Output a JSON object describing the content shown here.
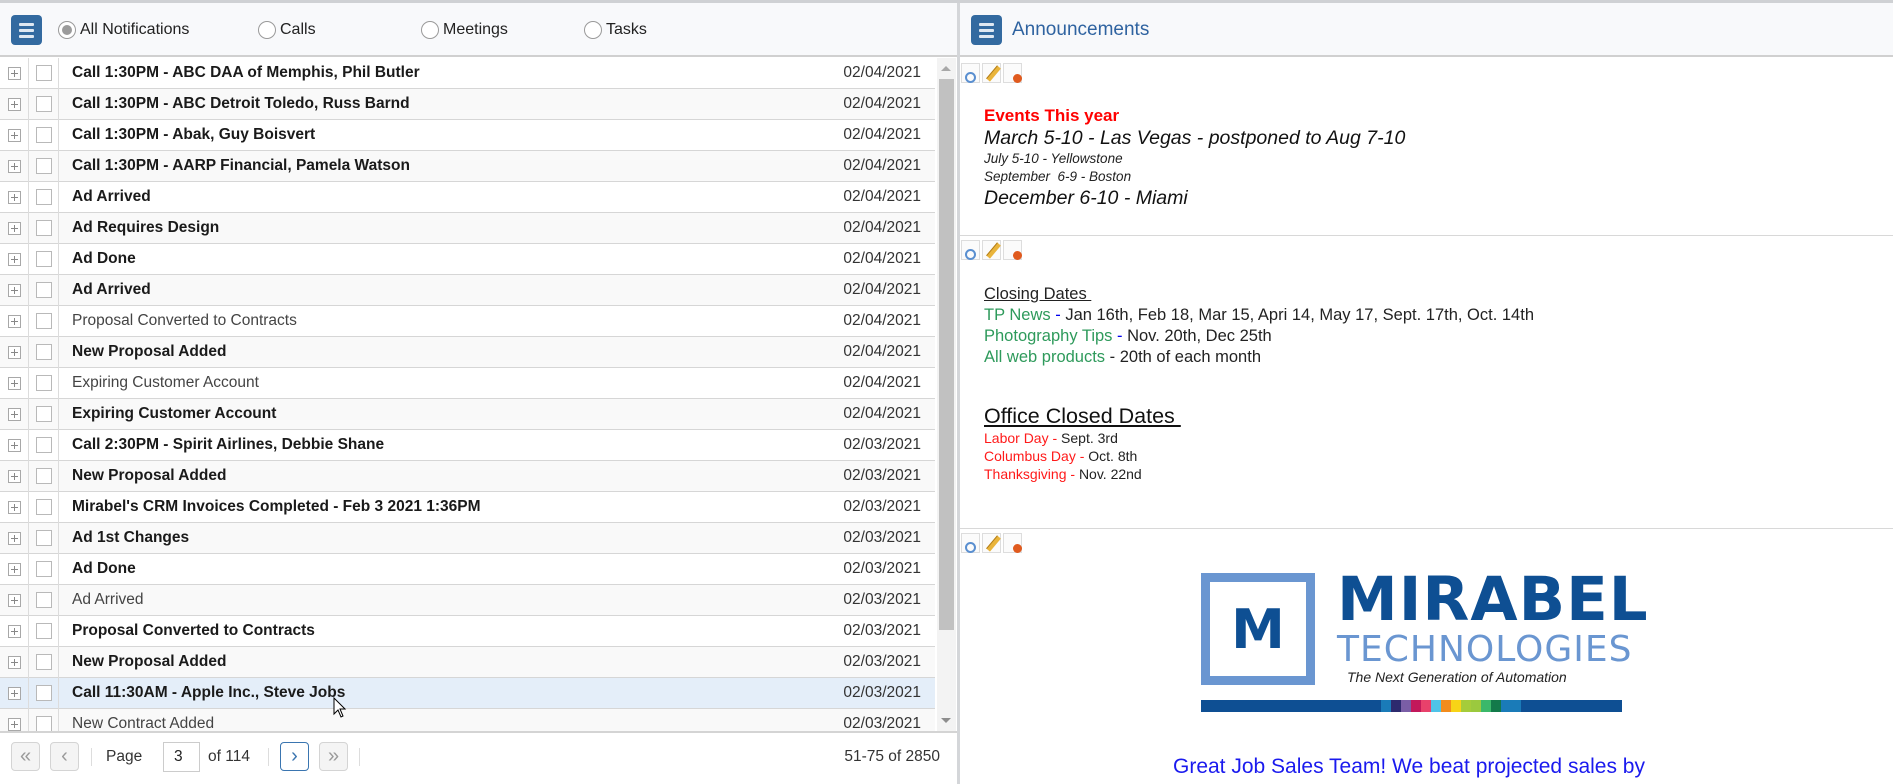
{
  "left_panel": {
    "filters": [
      {
        "label": "All Notifications",
        "selected": true
      },
      {
        "label": "Calls",
        "selected": false
      },
      {
        "label": "Meetings",
        "selected": false
      },
      {
        "label": "Tasks",
        "selected": false
      }
    ],
    "rows": [
      {
        "title": "Call 1:30PM - ABC DAA of Memphis, Phil Butler",
        "date": "02/04/2021",
        "unread": true
      },
      {
        "title": "Call 1:30PM - ABC Detroit Toledo, Russ Barnd",
        "date": "02/04/2021",
        "unread": true
      },
      {
        "title": "Call 1:30PM - Abak, Guy Boisvert",
        "date": "02/04/2021",
        "unread": true
      },
      {
        "title": "Call 1:30PM - AARP Financial, Pamela Watson",
        "date": "02/04/2021",
        "unread": true
      },
      {
        "title": "Ad Arrived",
        "date": "02/04/2021",
        "unread": true
      },
      {
        "title": "Ad Requires Design",
        "date": "02/04/2021",
        "unread": true
      },
      {
        "title": "Ad Done",
        "date": "02/04/2021",
        "unread": true
      },
      {
        "title": "Ad Arrived",
        "date": "02/04/2021",
        "unread": true
      },
      {
        "title": "Proposal Converted to Contracts",
        "date": "02/04/2021",
        "unread": false
      },
      {
        "title": "New Proposal Added",
        "date": "02/04/2021",
        "unread": true
      },
      {
        "title": "Expiring Customer Account",
        "date": "02/04/2021",
        "unread": false
      },
      {
        "title": "Expiring Customer Account",
        "date": "02/04/2021",
        "unread": true
      },
      {
        "title": "Call 2:30PM - Spirit Airlines, Debbie Shane",
        "date": "02/03/2021",
        "unread": true
      },
      {
        "title": "New Proposal Added",
        "date": "02/03/2021",
        "unread": true
      },
      {
        "title": "Mirabel's CRM Invoices Completed - Feb 3 2021 1:36PM",
        "date": "02/03/2021",
        "unread": true
      },
      {
        "title": "Ad 1st Changes",
        "date": "02/03/2021",
        "unread": true
      },
      {
        "title": "Ad Done",
        "date": "02/03/2021",
        "unread": true
      },
      {
        "title": "Ad Arrived",
        "date": "02/03/2021",
        "unread": false
      },
      {
        "title": "Proposal Converted to Contracts",
        "date": "02/03/2021",
        "unread": true
      },
      {
        "title": "New Proposal Added",
        "date": "02/03/2021",
        "unread": true
      },
      {
        "title": "Call 11:30AM - Apple Inc., Steve Jobs",
        "date": "02/03/2021",
        "unread": true,
        "hovered": true
      },
      {
        "title": "New Contract Added",
        "date": "02/03/2021",
        "unread": false
      }
    ],
    "pager": {
      "page_label": "Page",
      "current_page": "3",
      "of_label": "of 114",
      "range_label": "51-75 of 2850",
      "first_icon": "«",
      "prev_icon": "‹",
      "next_icon": "›",
      "last_icon": "»"
    }
  },
  "right_panel": {
    "title": "Announcements",
    "events": {
      "title": "Events This year",
      "lines": [
        {
          "text": "March 5-10 - Las Vegas - postponed to Aug 7-10",
          "size": "big"
        },
        {
          "text": "July 5-10 - Yellowstone",
          "size": "small"
        },
        {
          "text": "September  6-9 - Boston",
          "size": "small"
        },
        {
          "text": "December 6-10 - Miami",
          "size": "big"
        }
      ]
    },
    "closing_dates": {
      "title": "Closing Dates ",
      "items": [
        {
          "name": "TP News",
          "sep": " - ",
          "dates": "Jan 16th, Feb 18, Mar 15, Apri 14, May 17, Sept. 17th, Oct. 14th"
        },
        {
          "name": "Photography Tips",
          "sep": " - ",
          "dates": "Nov. 20th, Dec 25th"
        },
        {
          "name": "All web products",
          "sep": " - ",
          "dates": "20th of each month"
        }
      ]
    },
    "office_closed": {
      "title": "Office Closed Dates ",
      "items": [
        {
          "name": "Labor Day - ",
          "date": "Sept. 3rd"
        },
        {
          "name": "Columbus Day - ",
          "date": "Oct. 8th"
        },
        {
          "name": "Thanksgiving - ",
          "date": "Nov. 22nd"
        }
      ]
    },
    "logo": {
      "mark": "M",
      "name": "MIRABEL",
      "sub": "TECHNOLOGIES",
      "tagline": "The Next Generation of Automation",
      "stripe_colors": [
        "#1a7bb8",
        "#2d2a6e",
        "#7a5ea6",
        "#c2185b",
        "#e8416b",
        "#4fc3e8",
        "#f28c1d",
        "#f7d417",
        "#a5cc3a",
        "#9bc93e",
        "#3bb86a",
        "#137a4a",
        "#1a7bb8",
        "#1a7bb8"
      ]
    },
    "message": "Great Job Sales Team! We beat projected sales by"
  },
  "colors": {
    "brand_blue": "#336aa0",
    "title_blue": "#2f63a0",
    "events_red": "#ff0000",
    "closing_green": "#2e9a5b",
    "message_blue": "#1a1aee"
  }
}
